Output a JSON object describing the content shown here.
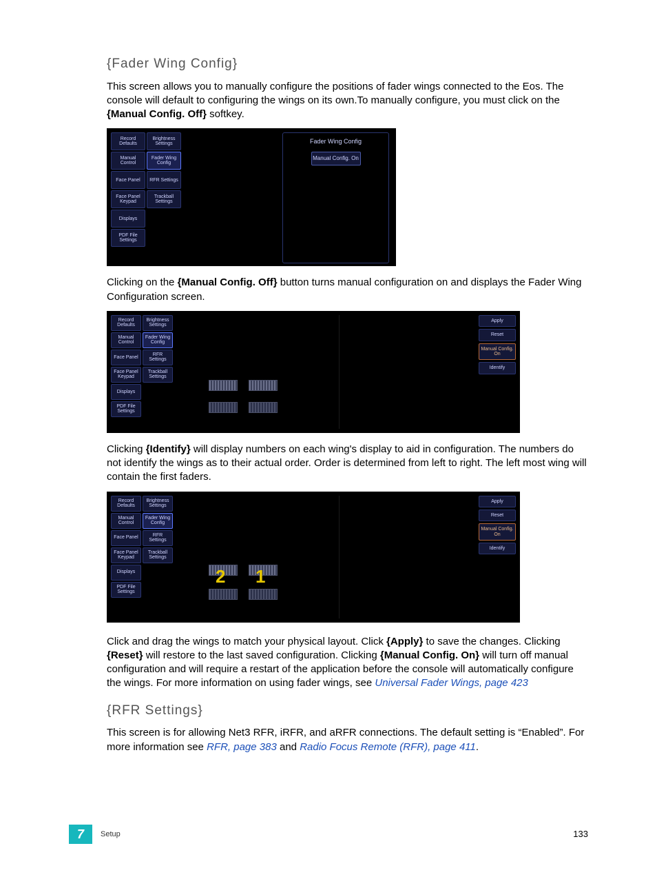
{
  "headings": {
    "fader": "{Fader Wing Config}",
    "rfr": "{RFR Settings}"
  },
  "para": {
    "p1a": "This screen allows you to manually configure the positions of fader wings connected to the Eos. The console will default to configuring the wings on its own.To manually configure, you must click on the ",
    "p1b": "{Manual Config. Off}",
    "p1c": " softkey.",
    "p2a": "Clicking on the ",
    "p2b": "{Manual Config. Off}",
    "p2c": " button turns manual configuration on and displays the Fader Wing Configuration screen.",
    "p3a": "Clicking ",
    "p3b": "{Identify}",
    "p3c": " will display numbers on each wing's display to aid in configuration. The numbers do not identify the wings as to their actual order. Order is determined from left to right. The left most wing will contain the first faders.",
    "p4a": "Click and drag the wings to match your physical layout. Click ",
    "p4b": "{Apply}",
    "p4c": " to save the changes. Clicking ",
    "p4d": "{Reset}",
    "p4e": " will restore to the last saved configuration. Clicking ",
    "p4f": "{Manual Config. On}",
    "p4g": " will turn off manual configuration and will require a restart of the application before the console will automatically configure the wings. For more information on using fader wings, see ",
    "p4link": "Universal Fader Wings, page 423",
    "p5a": "This screen is for allowing Net3 RFR, iRFR, and aRFR connections. The default setting is “Enabled”. For more information see ",
    "p5link1": "RFR, page 383",
    "p5mid": " and ",
    "p5link2": "Radio Focus Remote (RFR), page 411",
    "p5end": "."
  },
  "soft": {
    "record_defaults": "Record Defaults",
    "brightness": "Brightness Settings",
    "manual_control": "Manual Control",
    "fader_wing": "Fader Wing Config",
    "face_panel": "Face Panel",
    "rfr": "RFR Settings",
    "face_panel_keypad": "Face Panel Keypad",
    "trackball": "Trackball Settings",
    "displays": "Displays",
    "pdf": "PDF File Settings"
  },
  "panel": {
    "title": "Fader Wing Config",
    "manual_on": "Manual Config. On"
  },
  "actions": {
    "apply": "Apply",
    "reset": "Reset",
    "manual_on": "Manual Config. On",
    "identify": "Identify"
  },
  "wing_numbers": {
    "left": "2",
    "right": "1"
  },
  "footer": {
    "chapter": "7",
    "title": "Setup",
    "page": "133"
  }
}
